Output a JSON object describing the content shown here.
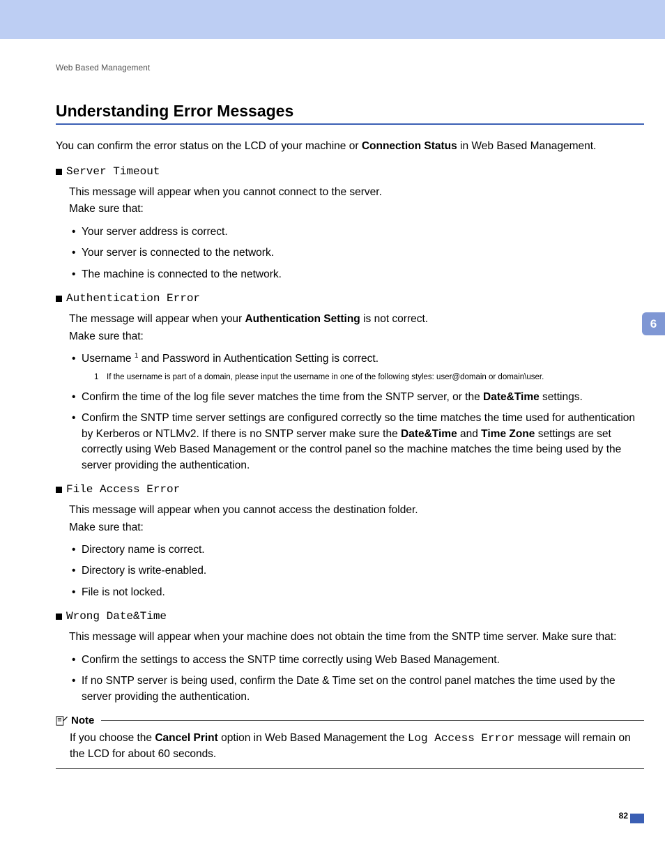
{
  "breadcrumb": "Web Based Management",
  "heading": "Understanding Error Messages",
  "intro_pre": "You can confirm the error status on the LCD of your machine or ",
  "intro_bold": "Connection Status",
  "intro_post": " in Web Based Management.",
  "items": [
    {
      "title": "Server Timeout",
      "desc1": "This message will appear when you cannot connect to the server.",
      "desc2": "Make sure that:",
      "bullets": [
        "Your server address is correct.",
        "Your server is connected to the network.",
        "The machine is connected to the network."
      ]
    },
    {
      "title": "Authentication Error",
      "desc_pre": "The message will appear when your ",
      "desc_bold": "Authentication Setting",
      "desc_post": " is not correct.",
      "desc2": "Make sure that:",
      "b1_pre": "Username ",
      "b1_post": " and Password in Authentication Setting is correct.",
      "fn_num": "1",
      "footnote": "If the username is part of a domain, please input the username in one of the following styles: user@domain or domain\\user.",
      "b2_pre": "Confirm the time of the log file sever matches the time from the SNTP server, or the ",
      "b2_bold": "Date&Time",
      "b2_post": " settings.",
      "b3_pre": "Confirm the SNTP time server settings are configured correctly so the time matches the time used for authentication by Kerberos or NTLMv2. If there is no SNTP server make sure the ",
      "b3_bold1": "Date&Time",
      "b3_mid": " and ",
      "b3_bold2": "Time Zone",
      "b3_post": " settings are set correctly using Web Based Management or the control panel so the machine matches the time being used by the server providing the authentication."
    },
    {
      "title": "File Access Error",
      "desc1": "This message will appear when you cannot access the destination folder.",
      "desc2": "Make sure that:",
      "bullets": [
        "Directory name is correct.",
        "Directory is write-enabled.",
        "File is not locked."
      ]
    },
    {
      "title": "Wrong Date&Time",
      "desc1": "This message will appear when your machine does not obtain the time from the SNTP time server. Make sure that:",
      "bullets": [
        "Confirm the settings to access the SNTP time correctly using Web Based Management.",
        "If no SNTP server is being used, confirm the Date & Time set on the control panel matches the time used by the server providing the authentication."
      ]
    }
  ],
  "note": {
    "label": "Note",
    "pre": "If you choose the ",
    "bold": "Cancel Print",
    "mid": " option in Web Based Management the ",
    "mono": "Log Access Error",
    "post": " message will remain on the LCD for about 60 seconds."
  },
  "side_tab": "6",
  "page_number": "82"
}
